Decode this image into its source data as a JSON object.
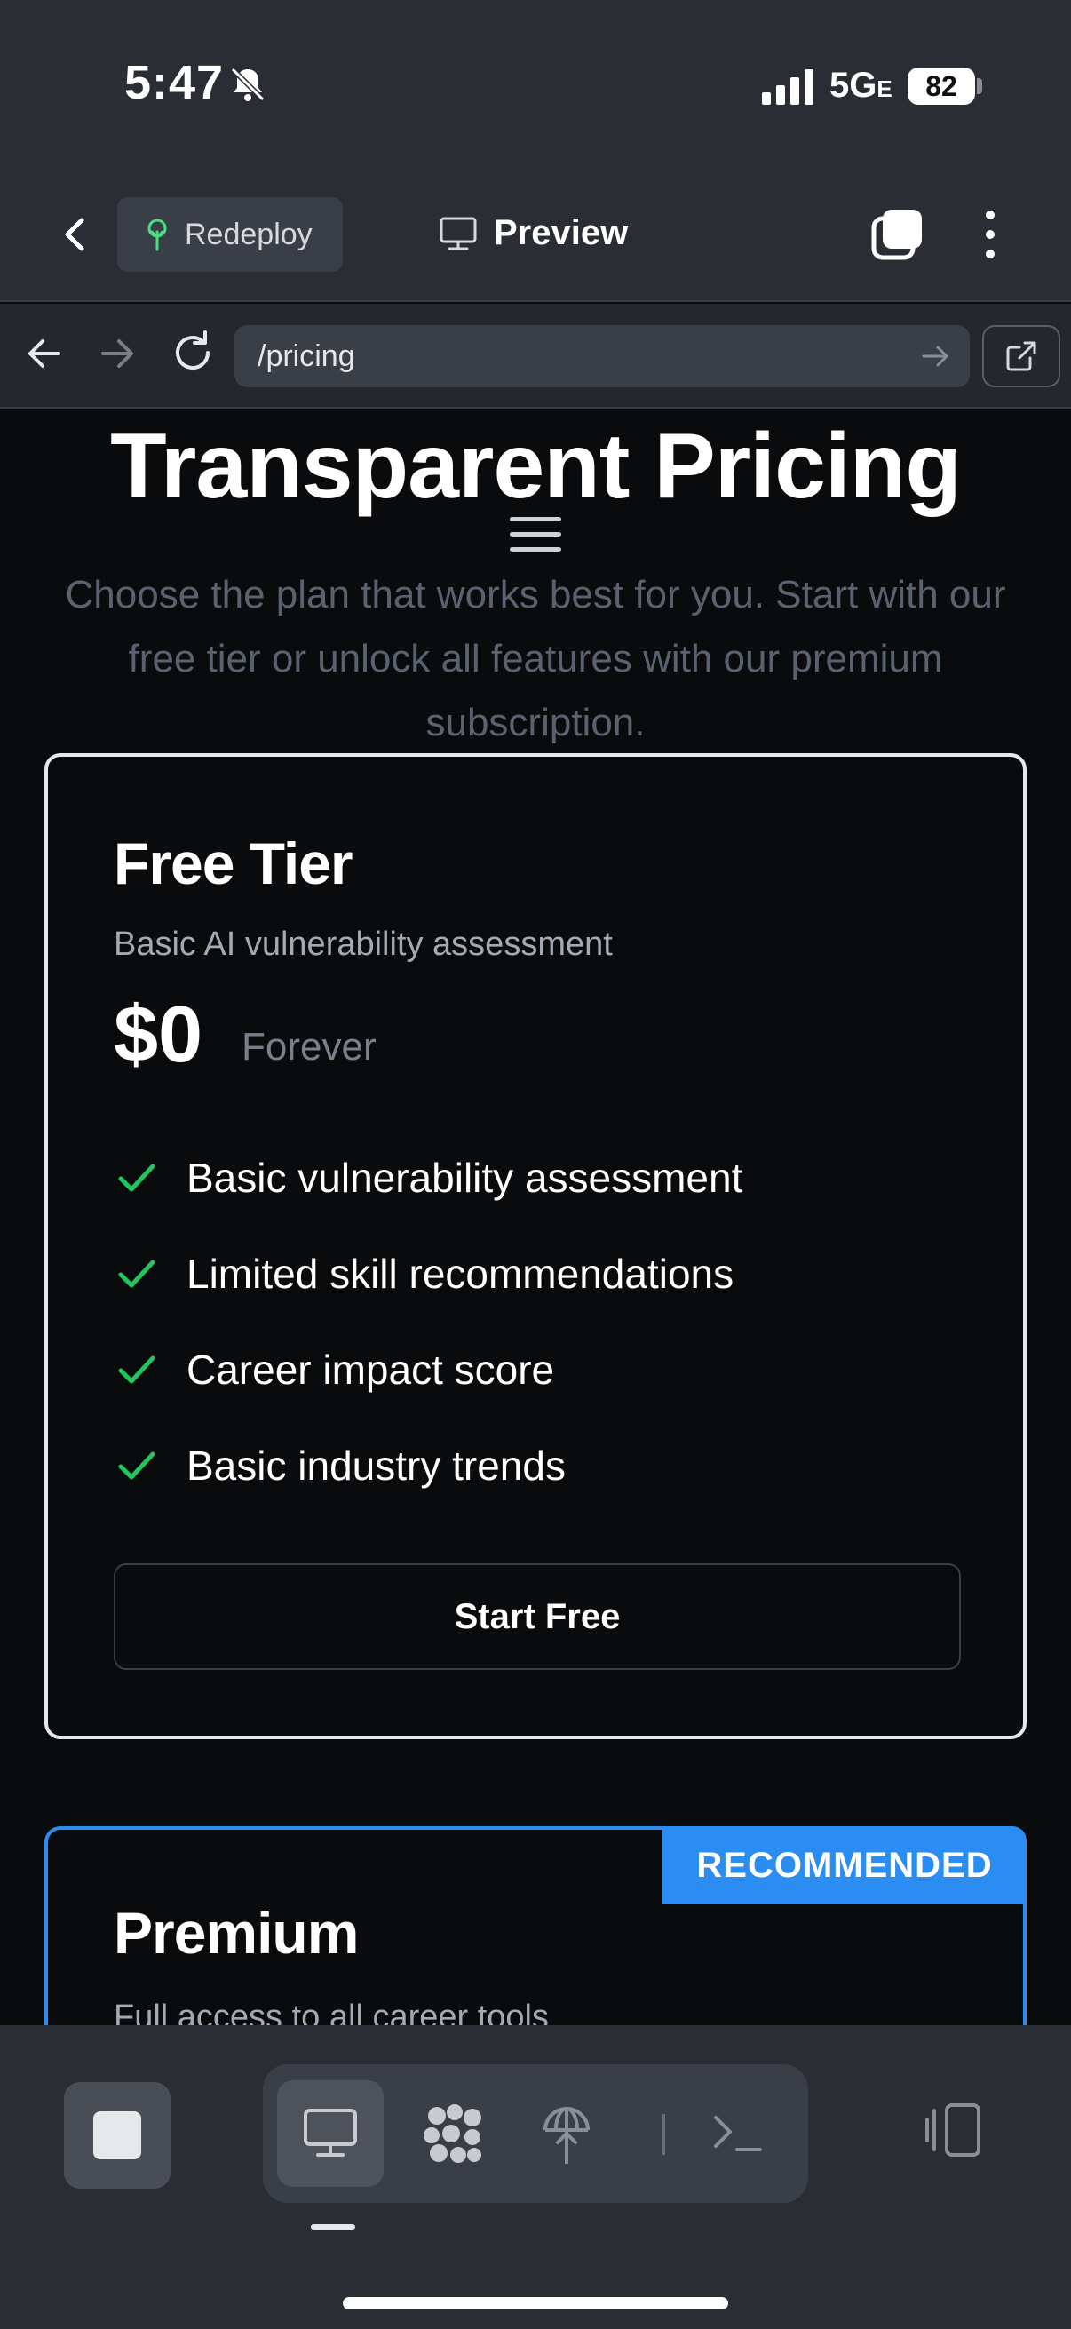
{
  "status_bar": {
    "time": "5:47",
    "network": "5G",
    "network_suffix": "E",
    "battery": "82"
  },
  "toolbar": {
    "redeploy_label": "Redeploy",
    "preview_label": "Preview"
  },
  "url_bar": {
    "url": "/pricing"
  },
  "page": {
    "title": "Transparent Pricing",
    "subtitle": "Choose the plan that works best for you. Start with our free tier or unlock all features with our premium subscription.",
    "plans": [
      {
        "name": "Free Tier",
        "description": "Basic AI vulnerability assessment",
        "price": "$0",
        "period": "Forever",
        "features": [
          "Basic vulnerability assessment",
          "Limited skill recommendations",
          "Career impact score",
          "Basic industry trends"
        ],
        "cta": "Start Free"
      },
      {
        "name": "Premium",
        "description": "Full access to all career tools",
        "badge": "RECOMMENDED"
      }
    ]
  },
  "colors": {
    "accent": "#2b8cf2",
    "check": "#22c55e",
    "background": "#0a0b0d",
    "chrome": "#2a2d34"
  },
  "icons": {
    "status": [
      "bell-slash-icon",
      "signal-icon"
    ],
    "toolbar": [
      "chevron-left-icon",
      "sprout-icon",
      "monitor-icon",
      "tabs-icon",
      "more-vertical-icon"
    ],
    "url_bar": [
      "arrow-left-icon",
      "arrow-right-icon",
      "reload-icon",
      "arrow-right-small-icon",
      "external-link-icon"
    ],
    "bottom": [
      "stop-icon",
      "monitor-icon",
      "cluster-icon",
      "deploy-icon",
      "terminal-icon",
      "panel-toggle-icon"
    ]
  }
}
